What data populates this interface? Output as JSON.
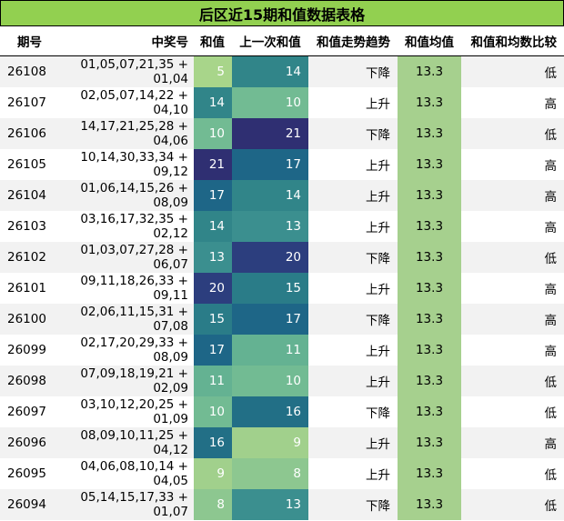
{
  "title": "后区近15期和值数据表格",
  "headers": [
    "期号",
    "中奖号",
    "和值",
    "上一次和值",
    "和值走势趋势",
    "和值均值",
    "和值和均数比较"
  ],
  "colors": {
    "title_bg": "#92d050",
    "mean_bg": "#a6d08e",
    "scale": {
      "5": "#a8d58a",
      "8": "#8dc790",
      "9": "#a1d08c",
      "10": "#72bb93",
      "11": "#64b292",
      "13": "#3b8f8f",
      "14": "#318589",
      "15": "#2a7c88",
      "16": "#226f86",
      "17": "#1e6687",
      "20": "#2c3e7e",
      "21": "#2f2f72"
    }
  },
  "rows": [
    {
      "issue": "26108",
      "numbers": "01,05,07,21,35 + 01,04",
      "sum": 5,
      "prev": 14,
      "trend": "下降",
      "mean": "13.3",
      "cmp": "低"
    },
    {
      "issue": "26107",
      "numbers": "02,05,07,14,22 + 04,10",
      "sum": 14,
      "prev": 10,
      "trend": "上升",
      "mean": "13.3",
      "cmp": "高"
    },
    {
      "issue": "26106",
      "numbers": "14,17,21,25,28 + 04,06",
      "sum": 10,
      "prev": 21,
      "trend": "下降",
      "mean": "13.3",
      "cmp": "低"
    },
    {
      "issue": "26105",
      "numbers": "10,14,30,33,34 + 09,12",
      "sum": 21,
      "prev": 17,
      "trend": "上升",
      "mean": "13.3",
      "cmp": "高"
    },
    {
      "issue": "26104",
      "numbers": "01,06,14,15,26 + 08,09",
      "sum": 17,
      "prev": 14,
      "trend": "上升",
      "mean": "13.3",
      "cmp": "高"
    },
    {
      "issue": "26103",
      "numbers": "03,16,17,32,35 + 02,12",
      "sum": 14,
      "prev": 13,
      "trend": "上升",
      "mean": "13.3",
      "cmp": "高"
    },
    {
      "issue": "26102",
      "numbers": "01,03,07,27,28 + 06,07",
      "sum": 13,
      "prev": 20,
      "trend": "下降",
      "mean": "13.3",
      "cmp": "低"
    },
    {
      "issue": "26101",
      "numbers": "09,11,18,26,33 + 09,11",
      "sum": 20,
      "prev": 15,
      "trend": "上升",
      "mean": "13.3",
      "cmp": "高"
    },
    {
      "issue": "26100",
      "numbers": "02,06,11,15,31 + 07,08",
      "sum": 15,
      "prev": 17,
      "trend": "下降",
      "mean": "13.3",
      "cmp": "高"
    },
    {
      "issue": "26099",
      "numbers": "02,17,20,29,33 + 08,09",
      "sum": 17,
      "prev": 11,
      "trend": "上升",
      "mean": "13.3",
      "cmp": "高"
    },
    {
      "issue": "26098",
      "numbers": "07,09,18,19,21 + 02,09",
      "sum": 11,
      "prev": 10,
      "trend": "上升",
      "mean": "13.3",
      "cmp": "低"
    },
    {
      "issue": "26097",
      "numbers": "03,10,12,20,25 + 01,09",
      "sum": 10,
      "prev": 16,
      "trend": "下降",
      "mean": "13.3",
      "cmp": "低"
    },
    {
      "issue": "26096",
      "numbers": "08,09,10,11,25 + 04,12",
      "sum": 16,
      "prev": 9,
      "trend": "上升",
      "mean": "13.3",
      "cmp": "高"
    },
    {
      "issue": "26095",
      "numbers": "04,06,08,10,14 + 04,05",
      "sum": 9,
      "prev": 8,
      "trend": "上升",
      "mean": "13.3",
      "cmp": "低"
    },
    {
      "issue": "26094",
      "numbers": "05,14,15,17,33 + 01,07",
      "sum": 8,
      "prev": 13,
      "trend": "下降",
      "mean": "13.3",
      "cmp": "低"
    }
  ]
}
